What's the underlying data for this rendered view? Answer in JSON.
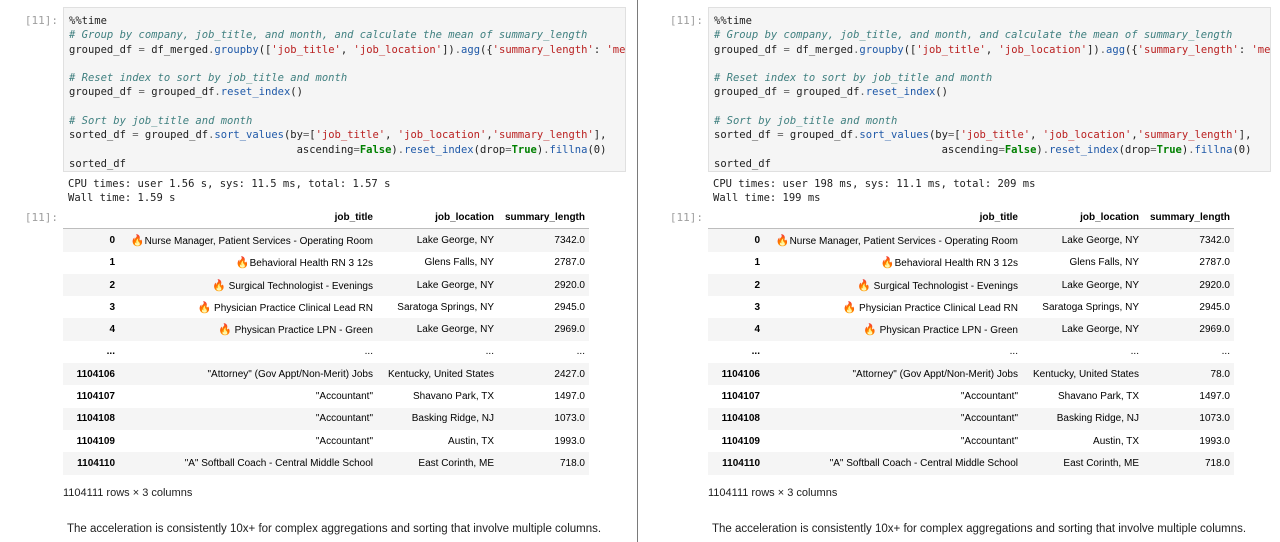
{
  "panels": [
    {
      "in_prompt": "[11]:",
      "out_prompt": "[11]:",
      "code": [
        {
          "cls": "tx",
          "text": "%%time"
        },
        {
          "cls": "cm",
          "text": "# Group by company, job_title, and month, and calculate the mean of summary_length"
        },
        {
          "cls": "mix",
          "parts": [
            {
              "c": "tx",
              "t": "grouped_df "
            },
            {
              "c": "op",
              "t": "="
            },
            {
              "c": "tx",
              "t": " df_merged"
            },
            {
              "c": "op",
              "t": "."
            },
            {
              "c": "fn",
              "t": "groupby"
            },
            {
              "c": "tx",
              "t": "(["
            },
            {
              "c": "st",
              "t": "'job_title'"
            },
            {
              "c": "tx",
              "t": ", "
            },
            {
              "c": "st",
              "t": "'job_location'"
            },
            {
              "c": "tx",
              "t": "])"
            },
            {
              "c": "op",
              "t": "."
            },
            {
              "c": "fn",
              "t": "agg"
            },
            {
              "c": "tx",
              "t": "({"
            },
            {
              "c": "st",
              "t": "'summary_length'"
            },
            {
              "c": "tx",
              "t": ": "
            },
            {
              "c": "st",
              "t": "'mean"
            }
          ]
        },
        {
          "cls": "tx",
          "text": ""
        },
        {
          "cls": "cm",
          "text": "# Reset index to sort by job_title and month"
        },
        {
          "cls": "mix",
          "parts": [
            {
              "c": "tx",
              "t": "grouped_df "
            },
            {
              "c": "op",
              "t": "="
            },
            {
              "c": "tx",
              "t": " grouped_df"
            },
            {
              "c": "op",
              "t": "."
            },
            {
              "c": "fn",
              "t": "reset_index"
            },
            {
              "c": "tx",
              "t": "()"
            }
          ]
        },
        {
          "cls": "tx",
          "text": ""
        },
        {
          "cls": "cm",
          "text": "# Sort by job_title and month"
        },
        {
          "cls": "mix",
          "parts": [
            {
              "c": "tx",
              "t": "sorted_df "
            },
            {
              "c": "op",
              "t": "="
            },
            {
              "c": "tx",
              "t": " grouped_df"
            },
            {
              "c": "op",
              "t": "."
            },
            {
              "c": "fn",
              "t": "sort_values"
            },
            {
              "c": "tx",
              "t": "(by"
            },
            {
              "c": "op",
              "t": "="
            },
            {
              "c": "tx",
              "t": "["
            },
            {
              "c": "st",
              "t": "'job_title'"
            },
            {
              "c": "tx",
              "t": ", "
            },
            {
              "c": "st",
              "t": "'job_location'"
            },
            {
              "c": "tx",
              "t": ","
            },
            {
              "c": "st",
              "t": "'summary_length'"
            },
            {
              "c": "tx",
              "t": "],"
            }
          ]
        },
        {
          "cls": "mix",
          "parts": [
            {
              "c": "tx",
              "t": "                                    ascending"
            },
            {
              "c": "op",
              "t": "="
            },
            {
              "c": "kw",
              "t": "False"
            },
            {
              "c": "tx",
              "t": ")"
            },
            {
              "c": "op",
              "t": "."
            },
            {
              "c": "fn",
              "t": "reset_index"
            },
            {
              "c": "tx",
              "t": "(drop"
            },
            {
              "c": "op",
              "t": "="
            },
            {
              "c": "kw",
              "t": "True"
            },
            {
              "c": "tx",
              "t": ")"
            },
            {
              "c": "op",
              "t": "."
            },
            {
              "c": "fn",
              "t": "fillna"
            },
            {
              "c": "tx",
              "t": "(0)"
            }
          ]
        },
        {
          "cls": "tx",
          "text": "sorted_df"
        }
      ],
      "stdout": [
        "CPU times: user 1.56 s, sys: 11.5 ms, total: 1.57 s",
        "Wall time: 1.59 s"
      ],
      "columns": [
        "job_title",
        "job_location",
        "summary_length"
      ],
      "rows": [
        {
          "idx": "0",
          "flame": true,
          "title": "Nurse Manager, Patient Services - Operating Room",
          "loc": "Lake George, NY",
          "len": "7342.0"
        },
        {
          "idx": "1",
          "flame": true,
          "title": "Behavioral Health RN 3 12s",
          "loc": "Glens Falls, NY",
          "len": "2787.0"
        },
        {
          "idx": "2",
          "flame": true,
          "title": " Surgical Technologist - Evenings",
          "loc": "Lake George, NY",
          "len": "2920.0"
        },
        {
          "idx": "3",
          "flame": true,
          "title": " Physician Practice Clinical Lead RN",
          "loc": "Saratoga Springs, NY",
          "len": "2945.0"
        },
        {
          "idx": "4",
          "flame": true,
          "title": " Physican Practice LPN - Green",
          "loc": "Lake George, NY",
          "len": "2969.0"
        },
        {
          "idx": "...",
          "flame": false,
          "title": "...",
          "loc": "...",
          "len": "..."
        },
        {
          "idx": "1104106",
          "flame": false,
          "title": "\"Attorney\" (Gov Appt/Non-Merit) Jobs",
          "loc": "Kentucky, United States",
          "len": "2427.0"
        },
        {
          "idx": "1104107",
          "flame": false,
          "title": "\"Accountant\"",
          "loc": "Shavano Park, TX",
          "len": "1497.0"
        },
        {
          "idx": "1104108",
          "flame": false,
          "title": "\"Accountant\"",
          "loc": "Basking Ridge, NJ",
          "len": "1073.0"
        },
        {
          "idx": "1104109",
          "flame": false,
          "title": "\"Accountant\"",
          "loc": "Austin, TX",
          "len": "1993.0"
        },
        {
          "idx": "1104110",
          "flame": false,
          "title": "\"A\" Softball Coach - Central Middle School",
          "loc": "East Corinth, ME",
          "len": "718.0"
        }
      ],
      "shape": "1104111 rows × 3 columns",
      "note": "The acceleration is consistently 10x+ for complex aggregations and sorting that involve multiple columns."
    },
    {
      "in_prompt": "[11]:",
      "out_prompt": "[11]:",
      "code": [
        {
          "cls": "tx",
          "text": "%%time"
        },
        {
          "cls": "cm",
          "text": "# Group by company, job_title, and month, and calculate the mean of summary_length"
        },
        {
          "cls": "mix",
          "parts": [
            {
              "c": "tx",
              "t": "grouped_df "
            },
            {
              "c": "op",
              "t": "="
            },
            {
              "c": "tx",
              "t": " df_merged"
            },
            {
              "c": "op",
              "t": "."
            },
            {
              "c": "fn",
              "t": "groupby"
            },
            {
              "c": "tx",
              "t": "(["
            },
            {
              "c": "st",
              "t": "'job_title'"
            },
            {
              "c": "tx",
              "t": ", "
            },
            {
              "c": "st",
              "t": "'job_location'"
            },
            {
              "c": "tx",
              "t": "])"
            },
            {
              "c": "op",
              "t": "."
            },
            {
              "c": "fn",
              "t": "agg"
            },
            {
              "c": "tx",
              "t": "({"
            },
            {
              "c": "st",
              "t": "'summary_length'"
            },
            {
              "c": "tx",
              "t": ": "
            },
            {
              "c": "st",
              "t": "'mean"
            }
          ]
        },
        {
          "cls": "tx",
          "text": ""
        },
        {
          "cls": "cm",
          "text": "# Reset index to sort by job_title and month"
        },
        {
          "cls": "mix",
          "parts": [
            {
              "c": "tx",
              "t": "grouped_df "
            },
            {
              "c": "op",
              "t": "="
            },
            {
              "c": "tx",
              "t": " grouped_df"
            },
            {
              "c": "op",
              "t": "."
            },
            {
              "c": "fn",
              "t": "reset_index"
            },
            {
              "c": "tx",
              "t": "()"
            }
          ]
        },
        {
          "cls": "tx",
          "text": ""
        },
        {
          "cls": "cm",
          "text": "# Sort by job_title and month"
        },
        {
          "cls": "mix",
          "parts": [
            {
              "c": "tx",
              "t": "sorted_df "
            },
            {
              "c": "op",
              "t": "="
            },
            {
              "c": "tx",
              "t": " grouped_df"
            },
            {
              "c": "op",
              "t": "."
            },
            {
              "c": "fn",
              "t": "sort_values"
            },
            {
              "c": "tx",
              "t": "(by"
            },
            {
              "c": "op",
              "t": "="
            },
            {
              "c": "tx",
              "t": "["
            },
            {
              "c": "st",
              "t": "'job_title'"
            },
            {
              "c": "tx",
              "t": ", "
            },
            {
              "c": "st",
              "t": "'job_location'"
            },
            {
              "c": "tx",
              "t": ","
            },
            {
              "c": "st",
              "t": "'summary_length'"
            },
            {
              "c": "tx",
              "t": "],"
            }
          ]
        },
        {
          "cls": "mix",
          "parts": [
            {
              "c": "tx",
              "t": "                                    ascending"
            },
            {
              "c": "op",
              "t": "="
            },
            {
              "c": "kw",
              "t": "False"
            },
            {
              "c": "tx",
              "t": ")"
            },
            {
              "c": "op",
              "t": "."
            },
            {
              "c": "fn",
              "t": "reset_index"
            },
            {
              "c": "tx",
              "t": "(drop"
            },
            {
              "c": "op",
              "t": "="
            },
            {
              "c": "kw",
              "t": "True"
            },
            {
              "c": "tx",
              "t": ")"
            },
            {
              "c": "op",
              "t": "."
            },
            {
              "c": "fn",
              "t": "fillna"
            },
            {
              "c": "tx",
              "t": "(0)"
            }
          ]
        },
        {
          "cls": "tx",
          "text": "sorted_df"
        }
      ],
      "stdout": [
        "CPU times: user 198 ms, sys: 11.1 ms, total: 209 ms",
        "Wall time: 199 ms"
      ],
      "columns": [
        "job_title",
        "job_location",
        "summary_length"
      ],
      "rows": [
        {
          "idx": "0",
          "flame": true,
          "title": "Nurse Manager, Patient Services - Operating Room",
          "loc": "Lake George, NY",
          "len": "7342.0"
        },
        {
          "idx": "1",
          "flame": true,
          "title": "Behavioral Health RN 3 12s",
          "loc": "Glens Falls, NY",
          "len": "2787.0"
        },
        {
          "idx": "2",
          "flame": true,
          "title": " Surgical Technologist - Evenings",
          "loc": "Lake George, NY",
          "len": "2920.0"
        },
        {
          "idx": "3",
          "flame": true,
          "title": " Physician Practice Clinical Lead RN",
          "loc": "Saratoga Springs, NY",
          "len": "2945.0"
        },
        {
          "idx": "4",
          "flame": true,
          "title": " Physican Practice LPN - Green",
          "loc": "Lake George, NY",
          "len": "2969.0"
        },
        {
          "idx": "...",
          "flame": false,
          "title": "...",
          "loc": "...",
          "len": "..."
        },
        {
          "idx": "1104106",
          "flame": false,
          "title": "\"Attorney\" (Gov Appt/Non-Merit) Jobs",
          "loc": "Kentucky, United States",
          "len": "78.0"
        },
        {
          "idx": "1104107",
          "flame": false,
          "title": "\"Accountant\"",
          "loc": "Shavano Park, TX",
          "len": "1497.0"
        },
        {
          "idx": "1104108",
          "flame": false,
          "title": "\"Accountant\"",
          "loc": "Basking Ridge, NJ",
          "len": "1073.0"
        },
        {
          "idx": "1104109",
          "flame": false,
          "title": "\"Accountant\"",
          "loc": "Austin, TX",
          "len": "1993.0"
        },
        {
          "idx": "1104110",
          "flame": false,
          "title": "\"A\" Softball Coach - Central Middle School",
          "loc": "East Corinth, ME",
          "len": "718.0"
        }
      ],
      "shape": "1104111 rows × 3 columns",
      "note": "The acceleration is consistently 10x+ for complex aggregations and sorting that involve multiple columns."
    }
  ]
}
